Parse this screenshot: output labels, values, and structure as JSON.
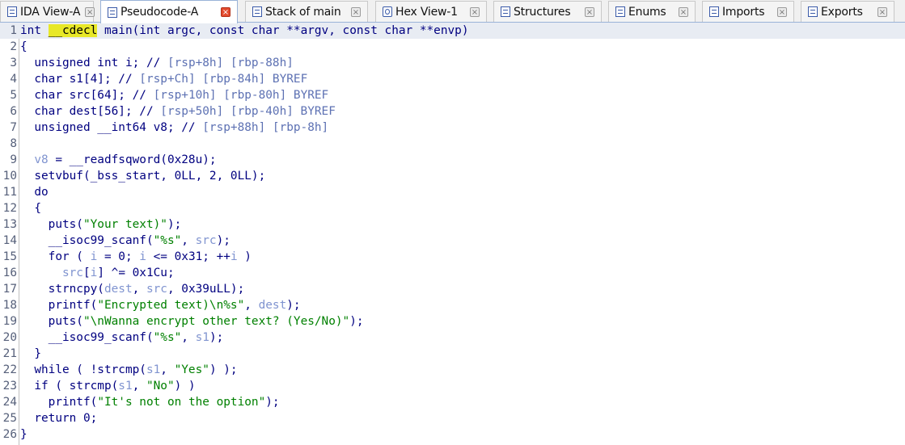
{
  "tabs": [
    {
      "label": "IDA View-A",
      "icon": "graph-view-icon",
      "active": false
    },
    {
      "label": "Pseudocode-A",
      "icon": "pseudocode-icon",
      "active": true
    },
    {
      "label": "Stack of main",
      "icon": "stack-icon",
      "active": false
    },
    {
      "label": "Hex View-1",
      "icon": "hex-view-icon",
      "active": false
    },
    {
      "label": "Structures",
      "icon": "structures-icon",
      "active": false
    },
    {
      "label": "Enums",
      "icon": "enums-icon",
      "active": false
    },
    {
      "label": "Imports",
      "icon": "imports-icon",
      "active": false
    },
    {
      "label": "Exports",
      "icon": "exports-icon",
      "active": false
    }
  ],
  "close_glyph": "×",
  "colors": {
    "keyword": "#000080",
    "variable": "#8094d0",
    "string": "#008000",
    "comment": "#5d71b3",
    "highlight": "#e8e828",
    "active_close": "#e34b2e"
  },
  "code": [
    {
      "n": "1",
      "segs": [
        {
          "t": "int ",
          "c": "k"
        },
        {
          "t": "__cdecl",
          "c": "hl"
        },
        {
          "t": " main(int argc, const char **argv, const char **envp)",
          "c": "k"
        }
      ]
    },
    {
      "n": "2",
      "segs": [
        {
          "t": "{",
          "c": "k"
        }
      ]
    },
    {
      "n": "3",
      "segs": [
        {
          "t": "  unsigned int i; // ",
          "c": "k"
        },
        {
          "t": "[rsp+8h] [rbp-88h]",
          "c": "c"
        }
      ]
    },
    {
      "n": "4",
      "segs": [
        {
          "t": "  char s1[4]; // ",
          "c": "k"
        },
        {
          "t": "[rsp+Ch] [rbp-84h] BYREF",
          "c": "c"
        }
      ]
    },
    {
      "n": "5",
      "segs": [
        {
          "t": "  char src[64]; // ",
          "c": "k"
        },
        {
          "t": "[rsp+10h] [rbp-80h] BYREF",
          "c": "c"
        }
      ]
    },
    {
      "n": "6",
      "segs": [
        {
          "t": "  char dest[56]; // ",
          "c": "k"
        },
        {
          "t": "[rsp+50h] [rbp-40h] BYREF",
          "c": "c"
        }
      ]
    },
    {
      "n": "7",
      "segs": [
        {
          "t": "  unsigned __int64 v8; // ",
          "c": "k"
        },
        {
          "t": "[rsp+88h] [rbp-8h]",
          "c": "c"
        }
      ]
    },
    {
      "n": "8",
      "segs": []
    },
    {
      "n": "9",
      "segs": [
        {
          "t": "  ",
          "c": "k"
        },
        {
          "t": "v8",
          "c": "v"
        },
        {
          "t": " = __readfsqword(0x28u);",
          "c": "k"
        }
      ]
    },
    {
      "n": "10",
      "segs": [
        {
          "t": "  setvbuf(_bss_start, 0LL, 2, 0LL);",
          "c": "k"
        }
      ]
    },
    {
      "n": "11",
      "segs": [
        {
          "t": "  do",
          "c": "k"
        }
      ]
    },
    {
      "n": "12",
      "segs": [
        {
          "t": "  {",
          "c": "k"
        }
      ]
    },
    {
      "n": "13",
      "segs": [
        {
          "t": "    puts(",
          "c": "k"
        },
        {
          "t": "\"Your text)\"",
          "c": "s"
        },
        {
          "t": ");",
          "c": "k"
        }
      ]
    },
    {
      "n": "14",
      "segs": [
        {
          "t": "    __isoc99_scanf(",
          "c": "k"
        },
        {
          "t": "\"%s\"",
          "c": "s"
        },
        {
          "t": ", ",
          "c": "k"
        },
        {
          "t": "src",
          "c": "v"
        },
        {
          "t": ");",
          "c": "k"
        }
      ]
    },
    {
      "n": "15",
      "segs": [
        {
          "t": "    for ( ",
          "c": "k"
        },
        {
          "t": "i",
          "c": "v"
        },
        {
          "t": " = 0; ",
          "c": "k"
        },
        {
          "t": "i",
          "c": "v"
        },
        {
          "t": " <= 0x31; ++",
          "c": "k"
        },
        {
          "t": "i",
          "c": "v"
        },
        {
          "t": " )",
          "c": "k"
        }
      ]
    },
    {
      "n": "16",
      "segs": [
        {
          "t": "      ",
          "c": "k"
        },
        {
          "t": "src",
          "c": "v"
        },
        {
          "t": "[",
          "c": "k"
        },
        {
          "t": "i",
          "c": "v"
        },
        {
          "t": "] ^= 0x1Cu;",
          "c": "k"
        }
      ]
    },
    {
      "n": "17",
      "segs": [
        {
          "t": "    strncpy(",
          "c": "k"
        },
        {
          "t": "dest",
          "c": "v"
        },
        {
          "t": ", ",
          "c": "k"
        },
        {
          "t": "src",
          "c": "v"
        },
        {
          "t": ", 0x39uLL);",
          "c": "k"
        }
      ]
    },
    {
      "n": "18",
      "segs": [
        {
          "t": "    printf(",
          "c": "k"
        },
        {
          "t": "\"Encrypted text)\\n%s\"",
          "c": "s"
        },
        {
          "t": ", ",
          "c": "k"
        },
        {
          "t": "dest",
          "c": "v"
        },
        {
          "t": ");",
          "c": "k"
        }
      ]
    },
    {
      "n": "19",
      "segs": [
        {
          "t": "    puts(",
          "c": "k"
        },
        {
          "t": "\"\\nWanna encrypt other text? (Yes/No)\"",
          "c": "s"
        },
        {
          "t": ");",
          "c": "k"
        }
      ]
    },
    {
      "n": "20",
      "segs": [
        {
          "t": "    __isoc99_scanf(",
          "c": "k"
        },
        {
          "t": "\"%s\"",
          "c": "s"
        },
        {
          "t": ", ",
          "c": "k"
        },
        {
          "t": "s1",
          "c": "v"
        },
        {
          "t": ");",
          "c": "k"
        }
      ]
    },
    {
      "n": "21",
      "segs": [
        {
          "t": "  }",
          "c": "k"
        }
      ]
    },
    {
      "n": "22",
      "segs": [
        {
          "t": "  while ( !strcmp(",
          "c": "k"
        },
        {
          "t": "s1",
          "c": "v"
        },
        {
          "t": ", ",
          "c": "k"
        },
        {
          "t": "\"Yes\"",
          "c": "s"
        },
        {
          "t": ") );",
          "c": "k"
        }
      ]
    },
    {
      "n": "23",
      "segs": [
        {
          "t": "  if ( strcmp(",
          "c": "k"
        },
        {
          "t": "s1",
          "c": "v"
        },
        {
          "t": ", ",
          "c": "k"
        },
        {
          "t": "\"No\"",
          "c": "s"
        },
        {
          "t": ") )",
          "c": "k"
        }
      ]
    },
    {
      "n": "24",
      "segs": [
        {
          "t": "    printf(",
          "c": "k"
        },
        {
          "t": "\"It's not on the option\"",
          "c": "s"
        },
        {
          "t": ");",
          "c": "k"
        }
      ]
    },
    {
      "n": "25",
      "segs": [
        {
          "t": "  return 0;",
          "c": "k"
        }
      ]
    },
    {
      "n": "26",
      "segs": [
        {
          "t": "}",
          "c": "k"
        }
      ]
    }
  ]
}
